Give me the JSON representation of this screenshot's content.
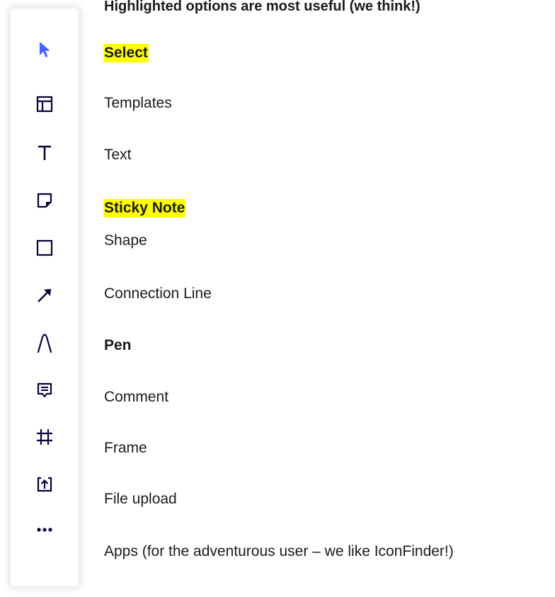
{
  "heading": "Highlighted options are most useful (we think!)",
  "colors": {
    "highlight": "#ffff00",
    "select_icon": "#4262ff",
    "icon": "#050038"
  },
  "tools": [
    {
      "icon": "cursor-arrow-icon",
      "label": "Select",
      "bold": true,
      "highlighted": true
    },
    {
      "icon": "templates-icon",
      "label": "Templates",
      "bold": false,
      "highlighted": false
    },
    {
      "icon": "text-icon",
      "label": "Text",
      "bold": false,
      "highlighted": false
    },
    {
      "icon": "sticky-note-icon",
      "label": "Sticky Note",
      "bold": true,
      "highlighted": true
    },
    {
      "icon": "square-shape-icon",
      "label": "Shape",
      "bold": false,
      "highlighted": false
    },
    {
      "icon": "arrow-line-icon",
      "label": "Connection Line",
      "bold": false,
      "highlighted": false
    },
    {
      "icon": "pen-icon",
      "label": "Pen",
      "bold": true,
      "highlighted": false
    },
    {
      "icon": "comment-icon",
      "label": "Comment",
      "bold": false,
      "highlighted": false
    },
    {
      "icon": "frame-icon",
      "label": "Frame",
      "bold": false,
      "highlighted": false
    },
    {
      "icon": "file-upload-icon",
      "label": "File upload",
      "bold": false,
      "highlighted": false
    },
    {
      "icon": "more-dots-icon",
      "label": "Apps (for the adventurous user – we like IconFinder!)",
      "bold": false,
      "highlighted": false
    }
  ]
}
